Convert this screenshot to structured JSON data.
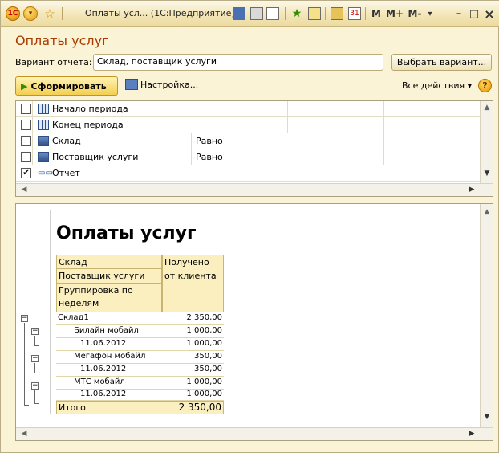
{
  "titlebar": {
    "title": "Оплаты усл... (1С:Предприятие)",
    "m_label": "M",
    "m_plus_label": "M+",
    "m_minus_label": "M-",
    "minimize": "–",
    "restore": "□",
    "close": "×"
  },
  "form": {
    "title": "Оплаты услуг",
    "variant_label": "Вариант отчета:",
    "variant_value": "Склад, поставщик услуги",
    "choose_variant_label": "Выбрать вариант...",
    "run_label": "Сформировать",
    "settings_label": "Настройка...",
    "all_actions_label": "Все действия ▾",
    "help": "?"
  },
  "settings": {
    "rows": [
      {
        "label": "Начало периода",
        "condition": "",
        "checked": false
      },
      {
        "label": "Конец периода",
        "condition": "",
        "checked": false
      },
      {
        "label": "Склад",
        "condition": "Равно",
        "checked": false
      },
      {
        "label": "Поставщик услуги",
        "condition": "Равно",
        "checked": false
      },
      {
        "label": "Отчет",
        "condition": "",
        "checked": true
      }
    ]
  },
  "report": {
    "title": "Оплаты услуг",
    "header": {
      "col1_line1": "Склад",
      "col1_line2": "Поставщик услуги",
      "col1_line3": "Группировка по",
      "col1_line4": "неделям",
      "col2_line1": "Получено",
      "col2_line2": "от клиента"
    },
    "rows": [
      {
        "label": "Склад1",
        "value": "2 350,00",
        "level": 0
      },
      {
        "label": "Билайн мобайл",
        "value": "1 000,00",
        "level": 1
      },
      {
        "label": "11.06.2012",
        "value": "1 000,00",
        "level": 2
      },
      {
        "label": "Мегафон мобайл",
        "value": "350,00",
        "level": 1
      },
      {
        "label": "11.06.2012",
        "value": "350,00",
        "level": 2
      },
      {
        "label": "МТС мобайл",
        "value": "1 000,00",
        "level": 1
      },
      {
        "label": "11.06.2012",
        "value": "1 000,00",
        "level": 2
      }
    ],
    "total_label": "Итого",
    "total_value": "2 350,00"
  }
}
